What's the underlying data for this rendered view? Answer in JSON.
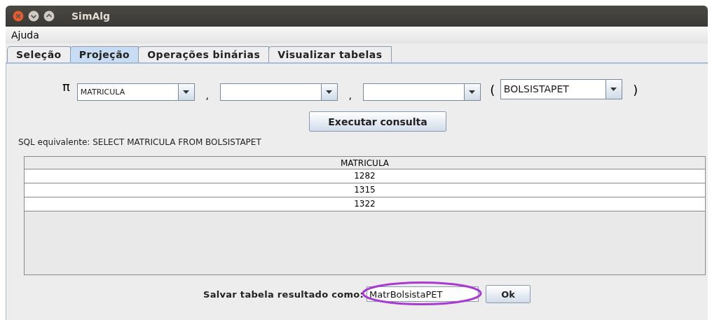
{
  "window": {
    "title": "SimAlg"
  },
  "menu": [
    "Ajuda"
  ],
  "tabs": [
    {
      "label": "Seleção",
      "selected": false
    },
    {
      "label": "Projeção",
      "selected": true
    },
    {
      "label": "Operações binárias",
      "selected": false
    },
    {
      "label": "Visualizar tabelas",
      "selected": false
    }
  ],
  "projection": {
    "symbol": "π",
    "column_selects": [
      {
        "kind": "filled",
        "value": "MATRICULA"
      },
      {
        "kind": "empty"
      },
      {
        "kind": "empty"
      }
    ],
    "separators": [
      ",",
      ","
    ],
    "open_paren": "(",
    "table_select": {
      "value": "BOLSISTAPET"
    },
    "close_paren": ")"
  },
  "run_button": "Executar consulta",
  "sql_text": "SQL equivalente: SELECT MATRICULA FROM BOLSISTAPET",
  "table": {
    "columns": [
      "MATRICULA"
    ],
    "rows": [
      [
        "1282"
      ],
      [
        "1315"
      ],
      [
        "1322"
      ]
    ]
  },
  "save": {
    "label": "Salvar tabela resultado como:",
    "value": "MatrBolsistaPET",
    "highlighted": true,
    "button": "Ok"
  }
}
